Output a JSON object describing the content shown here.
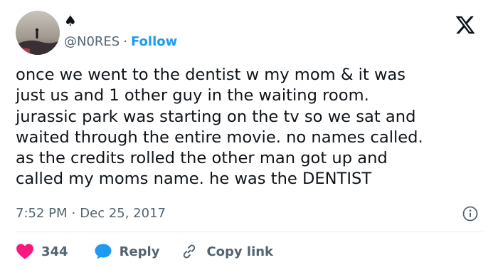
{
  "author": {
    "display_name": "♠",
    "handle": "@N0RES",
    "separator": "·",
    "follow_label": "Follow",
    "avatar_icon": "avatar-photo-silhouette"
  },
  "tweet": {
    "lines": [
      "once we went to the dentist w my mom & it was",
      "just us and 1 other guy in the waiting room.",
      "jurassic park was starting on the tv so we sat and",
      "waited through the entire movie. no names called.",
      "as the credits rolled the other man got up and",
      "called my moms name. he was the DENTIST"
    ],
    "time": "7:52 PM",
    "separator": "·",
    "date": "Dec 25, 2017"
  },
  "actions": {
    "likes": "344",
    "reply_label": "Reply",
    "copy_link_label": "Copy link"
  },
  "colors": {
    "text": "#0f1419",
    "secondary": "#536471",
    "accent": "#1d9bf0",
    "like": "#f91880",
    "divider": "#e6ecf0"
  },
  "icons": {
    "brand": "x-logo-icon",
    "info": "info-icon",
    "like": "heart-icon",
    "reply": "speech-bubble-icon",
    "copy": "link-icon"
  }
}
